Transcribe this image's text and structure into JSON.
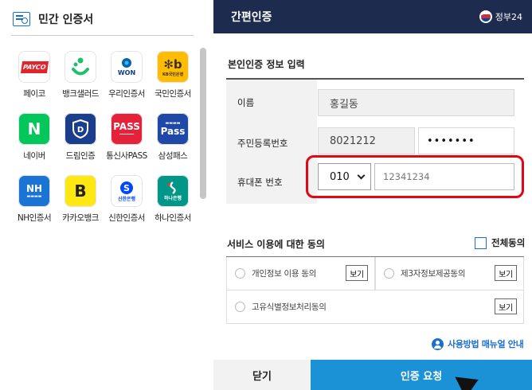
{
  "left": {
    "title": "민간 인증서",
    "providers": [
      {
        "label": "페이코",
        "logo": "PAYCO"
      },
      {
        "label": "뱅크샐러드",
        "logo": ""
      },
      {
        "label": "우리인증서",
        "logo": "WON"
      },
      {
        "label": "국민인증서",
        "logo": "KB국민은행"
      },
      {
        "label": "네이버",
        "logo": "N"
      },
      {
        "label": "드림인증",
        "logo": "D"
      },
      {
        "label": "통신사PASS",
        "logo": "PASS"
      },
      {
        "label": "삼성패스",
        "logo": "Pass"
      },
      {
        "label": "NH인증서",
        "logo": "NH"
      },
      {
        "label": "카카오뱅크",
        "logo": "B"
      },
      {
        "label": "신한인증서",
        "logo": "신한은행"
      },
      {
        "label": "하나인증서",
        "logo": "하나은행"
      }
    ]
  },
  "right": {
    "title": "간편인증",
    "gov_label": "정부24",
    "info_section_title": "본인인증 정보 입력",
    "fields": {
      "name_label": "이름",
      "name_value": "홍길동",
      "rrn_label": "주민등록번호",
      "rrn_front": "8021212",
      "rrn_back": "•••••••",
      "phone_label": "휴대폰 번호",
      "phone_prefix": "010",
      "phone_number": "12341234"
    },
    "consent": {
      "title": "서비스 이용에 대한 동의",
      "all_label": "전체동의",
      "items": [
        {
          "label": "개인정보 이용 동의",
          "view": "보기"
        },
        {
          "label": "제3자정보제공동의",
          "view": "보기"
        },
        {
          "label": "고유식별정보처리동의",
          "view": "보기"
        }
      ]
    },
    "manual_link": "사용방법 매뉴얼 안내",
    "close_button": "닫기",
    "request_button": "인증 요청"
  },
  "colors": {
    "topbar": "#1d2b4f",
    "primary_button": "#1b92d6",
    "highlight": "#e30613",
    "accent": "#1a6fd1"
  }
}
